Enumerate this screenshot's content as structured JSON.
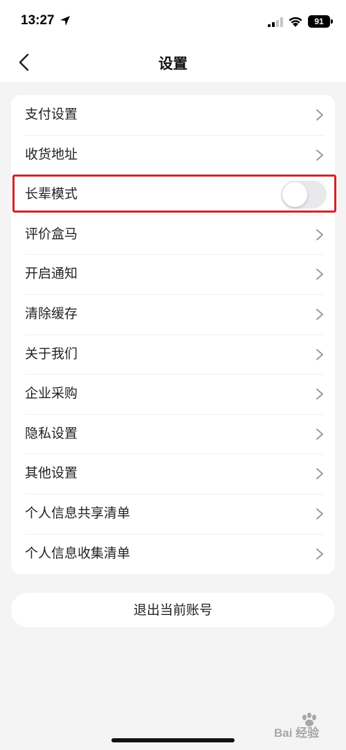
{
  "status_bar": {
    "time": "13:27",
    "battery": "91"
  },
  "nav": {
    "title": "设置"
  },
  "settings": {
    "items": [
      {
        "label": "支付设置",
        "type": "link"
      },
      {
        "label": "收货地址",
        "type": "link"
      },
      {
        "label": "长辈模式",
        "type": "toggle",
        "enabled": false
      },
      {
        "label": "评价盒马",
        "type": "link"
      },
      {
        "label": "开启通知",
        "type": "link"
      },
      {
        "label": "清除缓存",
        "type": "link"
      },
      {
        "label": "关于我们",
        "type": "link"
      },
      {
        "label": "企业采购",
        "type": "link"
      },
      {
        "label": "隐私设置",
        "type": "link"
      },
      {
        "label": "其他设置",
        "type": "link"
      },
      {
        "label": "个人信息共享清单",
        "type": "link"
      },
      {
        "label": "个人信息收集清单",
        "type": "link"
      }
    ]
  },
  "logout": {
    "label": "退出当前账号"
  },
  "colors": {
    "highlight": "#d91f26",
    "toggle_off": "#e9e9eb",
    "background": "#f4f4f4"
  },
  "watermark": {
    "text": "Bai 经验"
  }
}
